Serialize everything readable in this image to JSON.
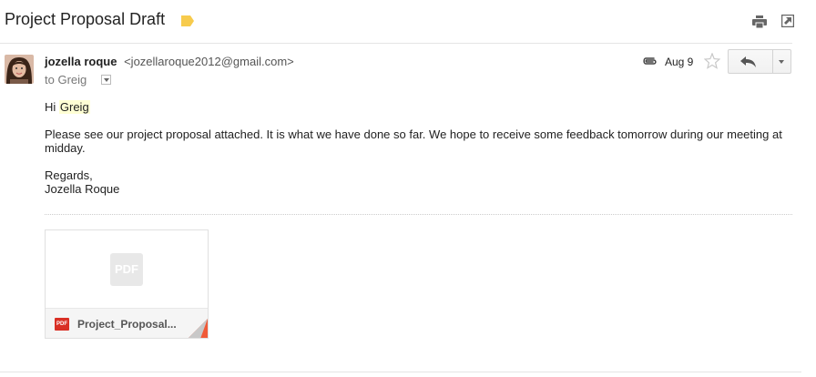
{
  "thread": {
    "subject": "Project Proposal Draft",
    "label_color": "#f7cb4d"
  },
  "toolbar": {
    "print_icon": "print-icon",
    "new_window_icon": "open-in-new-window-icon"
  },
  "message": {
    "sender_name": "jozella roque",
    "sender_email": "<jozellaroque2012@gmail.com>",
    "to_text": "to Greig",
    "date": "Aug 9",
    "has_attachment_icon": "paperclip-icon",
    "star_icon": "star-icon",
    "reply_icon": "reply-icon",
    "more_icon": "chevron-down-icon",
    "body": {
      "greeting_prefix": "Hi ",
      "greeting_name": "Greig",
      "paragraph": "Please see our project proposal attached. It is what we have done so far. We hope to receive some feedback tomorrow during our meeting at midday.",
      "signoff_1": "Regards,",
      "signoff_2": "Jozella Roque"
    },
    "attachment": {
      "thumb_label": "PDF",
      "badge_label": "PDF",
      "file_name": "Project_Proposal...",
      "badge_color": "#d93025"
    }
  }
}
